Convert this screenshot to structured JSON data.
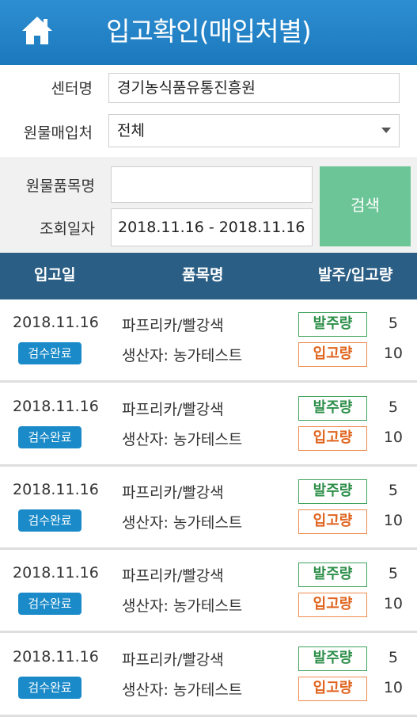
{
  "header": {
    "title": "입고확인(매입처별)",
    "home_icon": "home-icon"
  },
  "filters": {
    "center_label": "센터명",
    "center_value": "경기농식품유통진흥원",
    "supplier_label": "원물매입처",
    "supplier_value": "전체",
    "product_label": "원물품목명",
    "product_value": "",
    "date_label": "조회일자",
    "date_value": "2018.11.16 - 2018.11.16",
    "search_label": "검색"
  },
  "table": {
    "headers": [
      "입고일",
      "품목명",
      "발주/입고량"
    ],
    "order_tag": "발주량",
    "receive_tag": "입고량",
    "rows": [
      {
        "date": "2018.11.16",
        "status": "검수완료",
        "item": "파프리카/빨강색",
        "producer": "생산자: 농가테스트",
        "order_qty": "5",
        "receive_qty": "10"
      },
      {
        "date": "2018.11.16",
        "status": "검수완료",
        "item": "파프리카/빨강색",
        "producer": "생산자: 농가테스트",
        "order_qty": "5",
        "receive_qty": "10"
      },
      {
        "date": "2018.11.16",
        "status": "검수완료",
        "item": "파프리카/빨강색",
        "producer": "생산자: 농가테스트",
        "order_qty": "5",
        "receive_qty": "10"
      },
      {
        "date": "2018.11.16",
        "status": "검수완료",
        "item": "파프리카/빨강색",
        "producer": "생산자: 농가테스트",
        "order_qty": "5",
        "receive_qty": "10"
      },
      {
        "date": "2018.11.16",
        "status": "검수완료",
        "item": "파프리카/빨강색",
        "producer": "생산자: 농가테스트",
        "order_qty": "5",
        "receive_qty": "10"
      }
    ]
  },
  "colors": {
    "appbar": "#2384c7",
    "table_header": "#2b5e85",
    "search_button": "#6cc596",
    "status_badge": "#1a8ac8",
    "order_tag": "#3fa25c",
    "receive_tag": "#ef8b4d"
  }
}
